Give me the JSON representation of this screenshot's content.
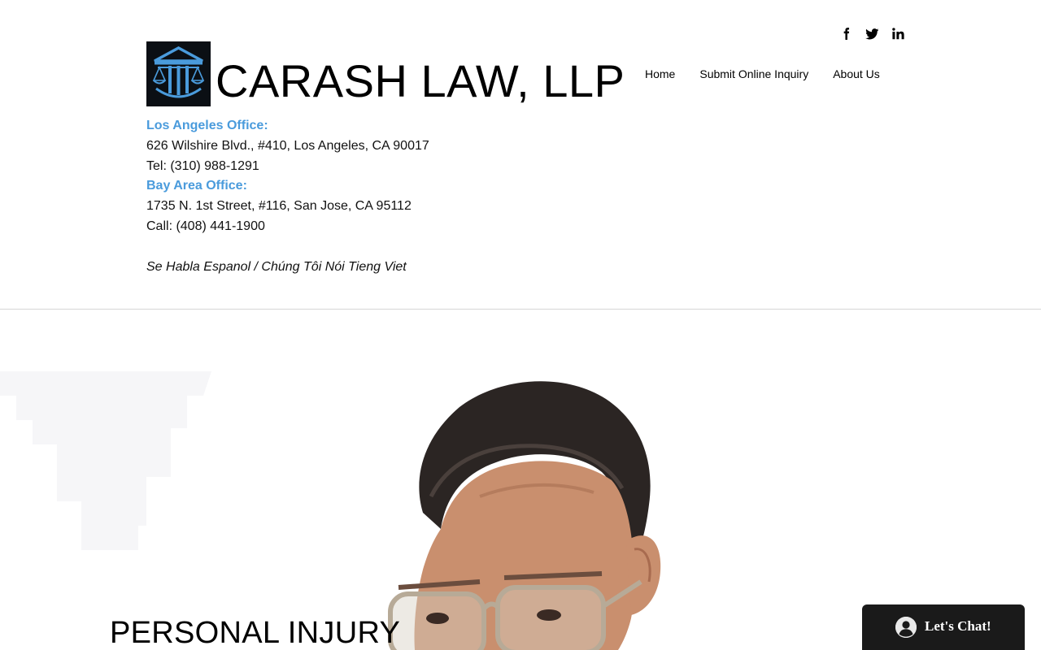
{
  "brand": {
    "name": "CARASH LAW, LLP",
    "logo_icon": "scales-of-justice-pillars-icon",
    "logo_color": "#4a9bdc"
  },
  "social": [
    {
      "icon": "facebook-icon"
    },
    {
      "icon": "twitter-icon"
    },
    {
      "icon": "linkedin-icon"
    }
  ],
  "nav": {
    "items": [
      "Home",
      "Submit Online Inquiry",
      "About Us"
    ]
  },
  "offices": {
    "la": {
      "title": "Los Angeles Office:",
      "address": "626 Wilshire Blvd., #410, Los Angeles, CA 90017",
      "phone": "Tel: (310) 988-1291"
    },
    "bay": {
      "title": "Bay Area Office:",
      "address": "1735 N. 1st Street, #116, San Jose, CA 95112",
      "phone": "Call: (408) 441-1900"
    },
    "languages": "Se Habla Espanol / Chúng Tôi Nói Tieng Viet"
  },
  "hero": {
    "title": "PERSONAL INJURY"
  },
  "chat": {
    "label": "Let's Chat!",
    "icon": "user-avatar-icon"
  },
  "colors": {
    "accent": "#4a9bdc",
    "chat_bg": "#1a1a1a",
    "divider": "#d6d6d6"
  }
}
